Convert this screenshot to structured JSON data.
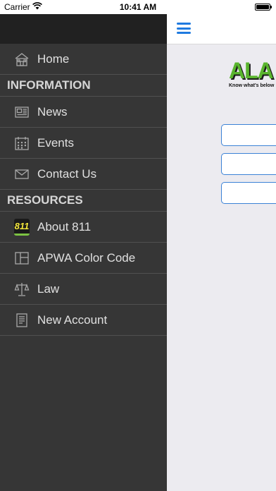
{
  "status_bar": {
    "carrier": "Carrier",
    "time": "10:41 AM"
  },
  "sidebar": {
    "home": {
      "label": "Home",
      "icon": "home-icon"
    },
    "sections": [
      {
        "title": "INFORMATION",
        "items": [
          {
            "label": "News",
            "icon": "newspaper-icon"
          },
          {
            "label": "Events",
            "icon": "calendar-icon"
          },
          {
            "label": "Contact Us",
            "icon": "envelope-icon"
          }
        ]
      },
      {
        "title": "RESOURCES",
        "items": [
          {
            "label": "About 811",
            "icon": "badge-811-icon",
            "badge_text": "811"
          },
          {
            "label": "APWA Color Code",
            "icon": "layout-icon"
          },
          {
            "label": "Law",
            "icon": "scales-icon"
          },
          {
            "label": "New Account",
            "icon": "document-icon"
          }
        ]
      }
    ]
  },
  "topbar": {
    "menu_icon": "hamburger-menu-icon",
    "accent": "#1f7ae0"
  },
  "logo": {
    "text": "ALA",
    "tagline": "Know what's below",
    "brand_color": "#5ab52e"
  },
  "form": {
    "fields": [
      {
        "value": ""
      },
      {
        "value": ""
      },
      {
        "value": ""
      }
    ]
  }
}
